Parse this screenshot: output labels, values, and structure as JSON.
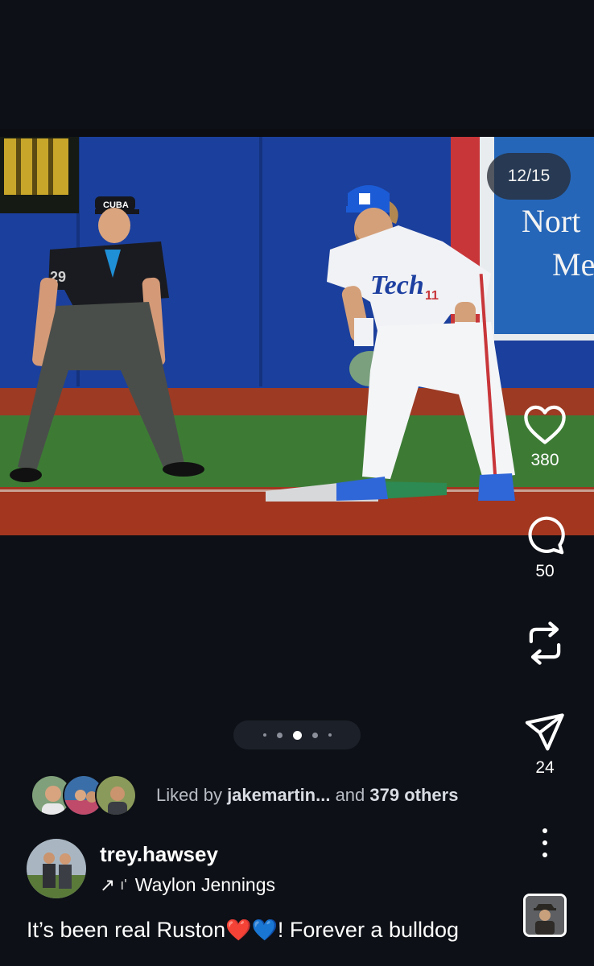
{
  "post": {
    "slide_counter": "12/15",
    "current_slide": 12,
    "total_slides": 15
  },
  "photo": {
    "description_icon": "baseball-photo",
    "banner_text_1": "Nort",
    "banner_text_2": "Me",
    "umpire_cap_text": "CUBA",
    "umpire_number": "29",
    "player_number": "11"
  },
  "actions": {
    "like_count": "380",
    "comment_count": "50",
    "share_count": "24"
  },
  "carousel_dots": {
    "count": 5,
    "active_index": 2
  },
  "likes": {
    "prefix": "Liked by ",
    "first_user": "jakemartin...",
    "middle": " and ",
    "others": "379 others"
  },
  "author": {
    "username": "trey.hawsey",
    "audio_arrow": "↗",
    "audio_wave": "ı'",
    "audio_title": "Waylon Jennings"
  },
  "caption": {
    "text_before": "It’s been real Ruston",
    "emoji_1": "❤️",
    "emoji_2": "💙",
    "text_after": "! Forever a bulldog"
  },
  "colors": {
    "background": "#0d1016",
    "wall_blue": "#1a3f9a",
    "infield_clay": "#a43a22",
    "grass": "#3c7a36"
  }
}
